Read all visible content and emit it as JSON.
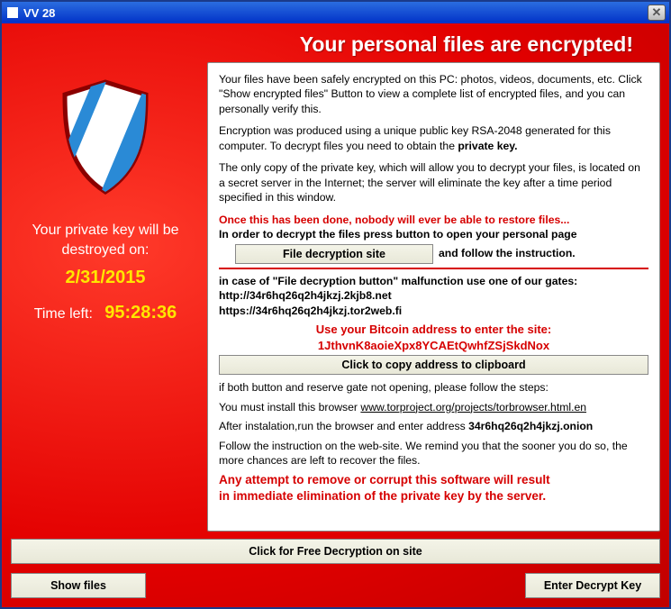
{
  "titlebar": {
    "title": "VV 28",
    "close_glyph": "✕"
  },
  "header": {
    "title": "Your personal files are encrypted!"
  },
  "left": {
    "willbe_l1": "Your private key will be",
    "willbe_l2": "destroyed on:",
    "date": "2/31/2015",
    "time_label": "Time left:",
    "time_value": "95:28:36"
  },
  "panel": {
    "p1": "Your files have been safely encrypted on this PC: photos, videos, documents, etc. Click \"Show encrypted files\" Button to view a complete list of encrypted files, and you can personally verify this.",
    "p2a": "Encryption was produced using a unique public key RSA-2048 generated for this computer. To decrypt files you need to obtain the ",
    "p2b": "private key.",
    "p3": "The only copy of the private key, which will allow you to decrypt your files, is located on a secret server in the Internet; the server will eliminate the key after a time period specified in this window.",
    "p4": "Once this has been done, nobody will ever be able to restore files...",
    "p5": "In order to decrypt the files press button to open your personal page",
    "btn_decryption": "File decryption site",
    "p5b": "and follow the instruction.",
    "p6": "in case of \"File decryption button\" malfunction use one of our gates:",
    "gate1": "http://34r6hq26q2h4jkzj.2kjb8.net",
    "gate2": "https://34r6hq26q2h4jkzj.tor2web.fi",
    "bitcoin_l1": "Use your Bitcoin address to  enter the site:",
    "bitcoin_l2": "1JthvnK8aoieXpx8YCAEtQwhfZSjSkdNox",
    "btn_copy": "Click to copy address to clipboard",
    "p8": "if both button and reserve gate not opening, please follow the steps:",
    "p9a": "You must install this browser ",
    "p9b": "www.torproject.org/projects/torbrowser.html.en",
    "p10a": "After instalation,run the browser and enter address ",
    "p10b": "34r6hq26q2h4jkzj.onion",
    "p11": "Follow the instruction on the web-site. We remind you that the sooner you do so, the more chances are left to recover the files.",
    "warn_l1": "Any attempt to remove or corrupt this software will result",
    "warn_l2": "in immediate elimination of the private key by the server."
  },
  "footer": {
    "btn_free": "Click for Free Decryption on site",
    "btn_show": "Show files",
    "btn_enter": "Enter Decrypt Key"
  }
}
